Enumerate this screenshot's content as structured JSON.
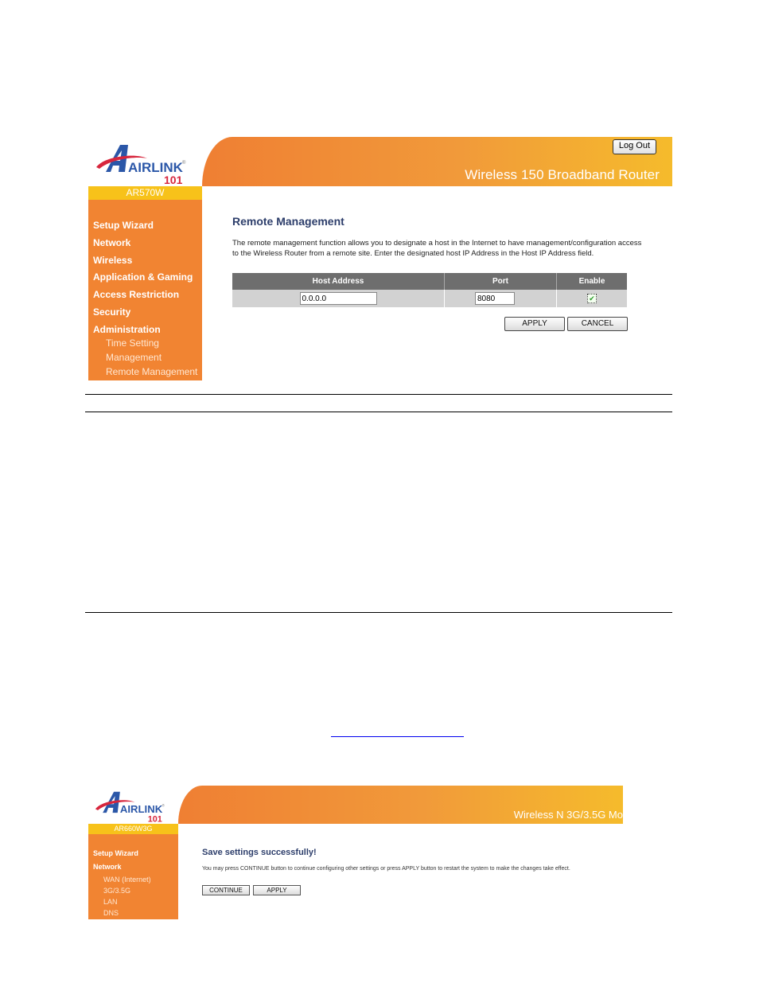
{
  "screenshot1": {
    "brand": {
      "logo_text": "AIRLINK",
      "logo_number": "101",
      "registered_mark": "®"
    },
    "banner_title": "Wireless 150 Broadband Router",
    "logout_label": "Log Out",
    "model": "AR570W",
    "sidebar": {
      "items": [
        {
          "label": "Setup Wizard"
        },
        {
          "label": "Network"
        },
        {
          "label": "Wireless"
        },
        {
          "label": "Application & Gaming"
        },
        {
          "label": "Access Restriction"
        },
        {
          "label": "Security"
        },
        {
          "label": "Administration"
        }
      ],
      "subitems": [
        {
          "label": "Time Setting"
        },
        {
          "label": "Management"
        },
        {
          "label": "Remote Management"
        }
      ]
    },
    "main": {
      "title": "Remote Management",
      "description": "The remote management function allows you to designate a host in the Internet to have management/configuration access to the Wireless Router from a remote site. Enter the designated host IP Address in the Host IP Address field.",
      "table": {
        "headers": [
          "Host Address",
          "Port",
          "Enable"
        ],
        "row": {
          "host_address": "0.0.0.0",
          "port": "8080",
          "enable": true
        }
      },
      "apply_label": "APPLY",
      "cancel_label": "CANCEL"
    },
    "colors": {
      "sidebar": "#f18432",
      "model_bar": "#f7c21a",
      "title": "#2d3e6b",
      "table_header": "#6e6e6e"
    }
  },
  "screenshot2": {
    "brand": {
      "logo_text": "AIRLINK",
      "logo_number": "101",
      "registered_mark": "®"
    },
    "banner_title": "Wireless N 3G/3.5G Mo",
    "model": "AR660W3G",
    "sidebar": {
      "items": [
        {
          "label": "Setup Wizard"
        },
        {
          "label": "Network"
        }
      ],
      "subitems": [
        {
          "label": "WAN (Internet)"
        },
        {
          "label": "3G/3.5G"
        },
        {
          "label": "LAN"
        },
        {
          "label": "DNS"
        }
      ]
    },
    "main": {
      "title": "Save settings successfully!",
      "description": "You may press CONTINUE button to continue configuring other settings or press APPLY button to restart the system to make the changes take effect.",
      "continue_label": "CONTINUE",
      "apply_label": "APPLY"
    }
  }
}
